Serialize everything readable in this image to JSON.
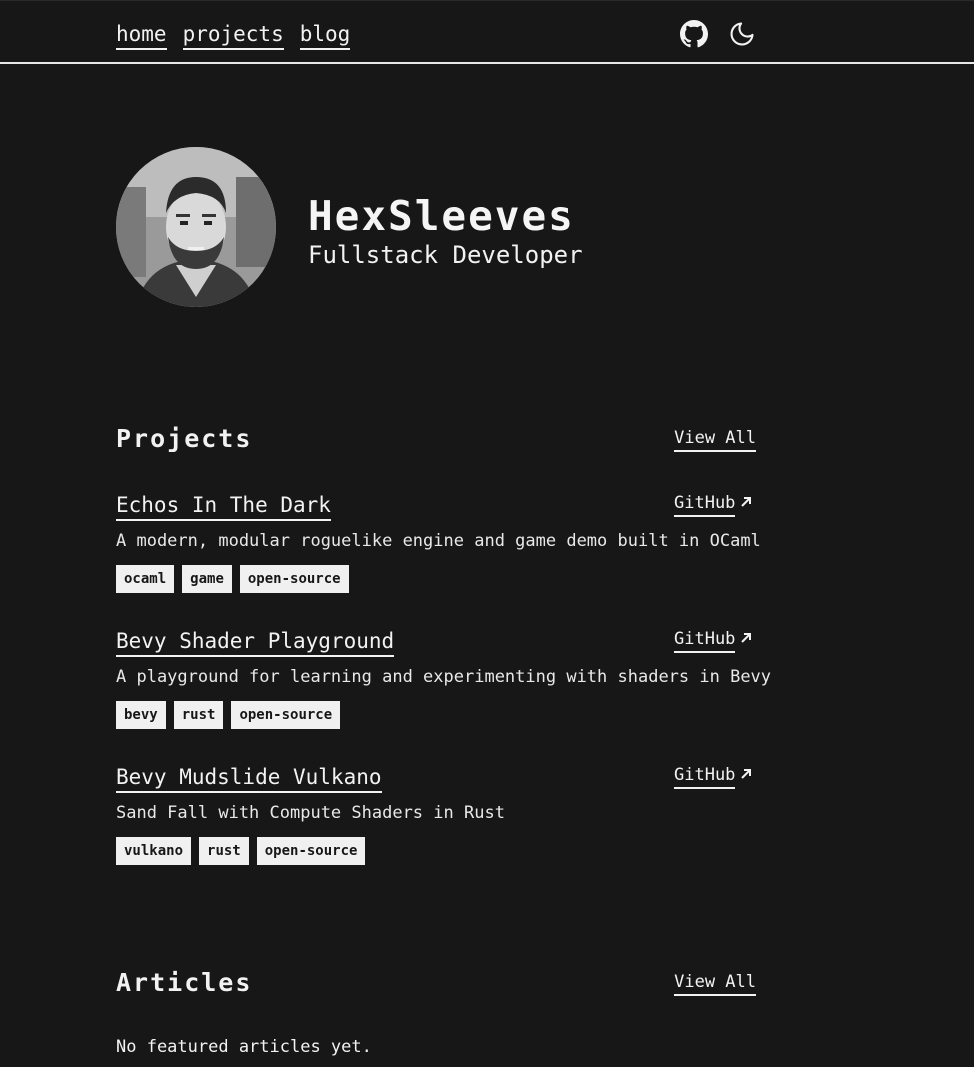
{
  "nav": {
    "links": [
      {
        "label": "home"
      },
      {
        "label": "projects"
      },
      {
        "label": "blog"
      }
    ],
    "icons": [
      "github-icon",
      "moon-icon"
    ]
  },
  "hero": {
    "name": "HexSleeves",
    "role": "Fullstack Developer"
  },
  "projects_section": {
    "title": "Projects",
    "view_all": "View All",
    "items": [
      {
        "title": "Echos In The Dark",
        "link_label": "GitHub",
        "description": "A modern, modular roguelike engine and game demo built in OCaml",
        "tags": [
          "ocaml",
          "game",
          "open-source"
        ]
      },
      {
        "title": "Bevy Shader Playground",
        "link_label": "GitHub",
        "description": "A playground for learning and experimenting with shaders in Bevy",
        "tags": [
          "bevy",
          "rust",
          "open-source"
        ]
      },
      {
        "title": "Bevy Mudslide Vulkano",
        "link_label": "GitHub",
        "description": "Sand Fall with Compute Shaders in Rust",
        "tags": [
          "vulkano",
          "rust",
          "open-source"
        ]
      }
    ]
  },
  "articles_section": {
    "title": "Articles",
    "view_all": "View All",
    "empty_text": "No featured articles yet."
  },
  "colors": {
    "background": "#171717",
    "foreground": "#f2f2f2",
    "tag_bg": "#f0f0f0"
  }
}
